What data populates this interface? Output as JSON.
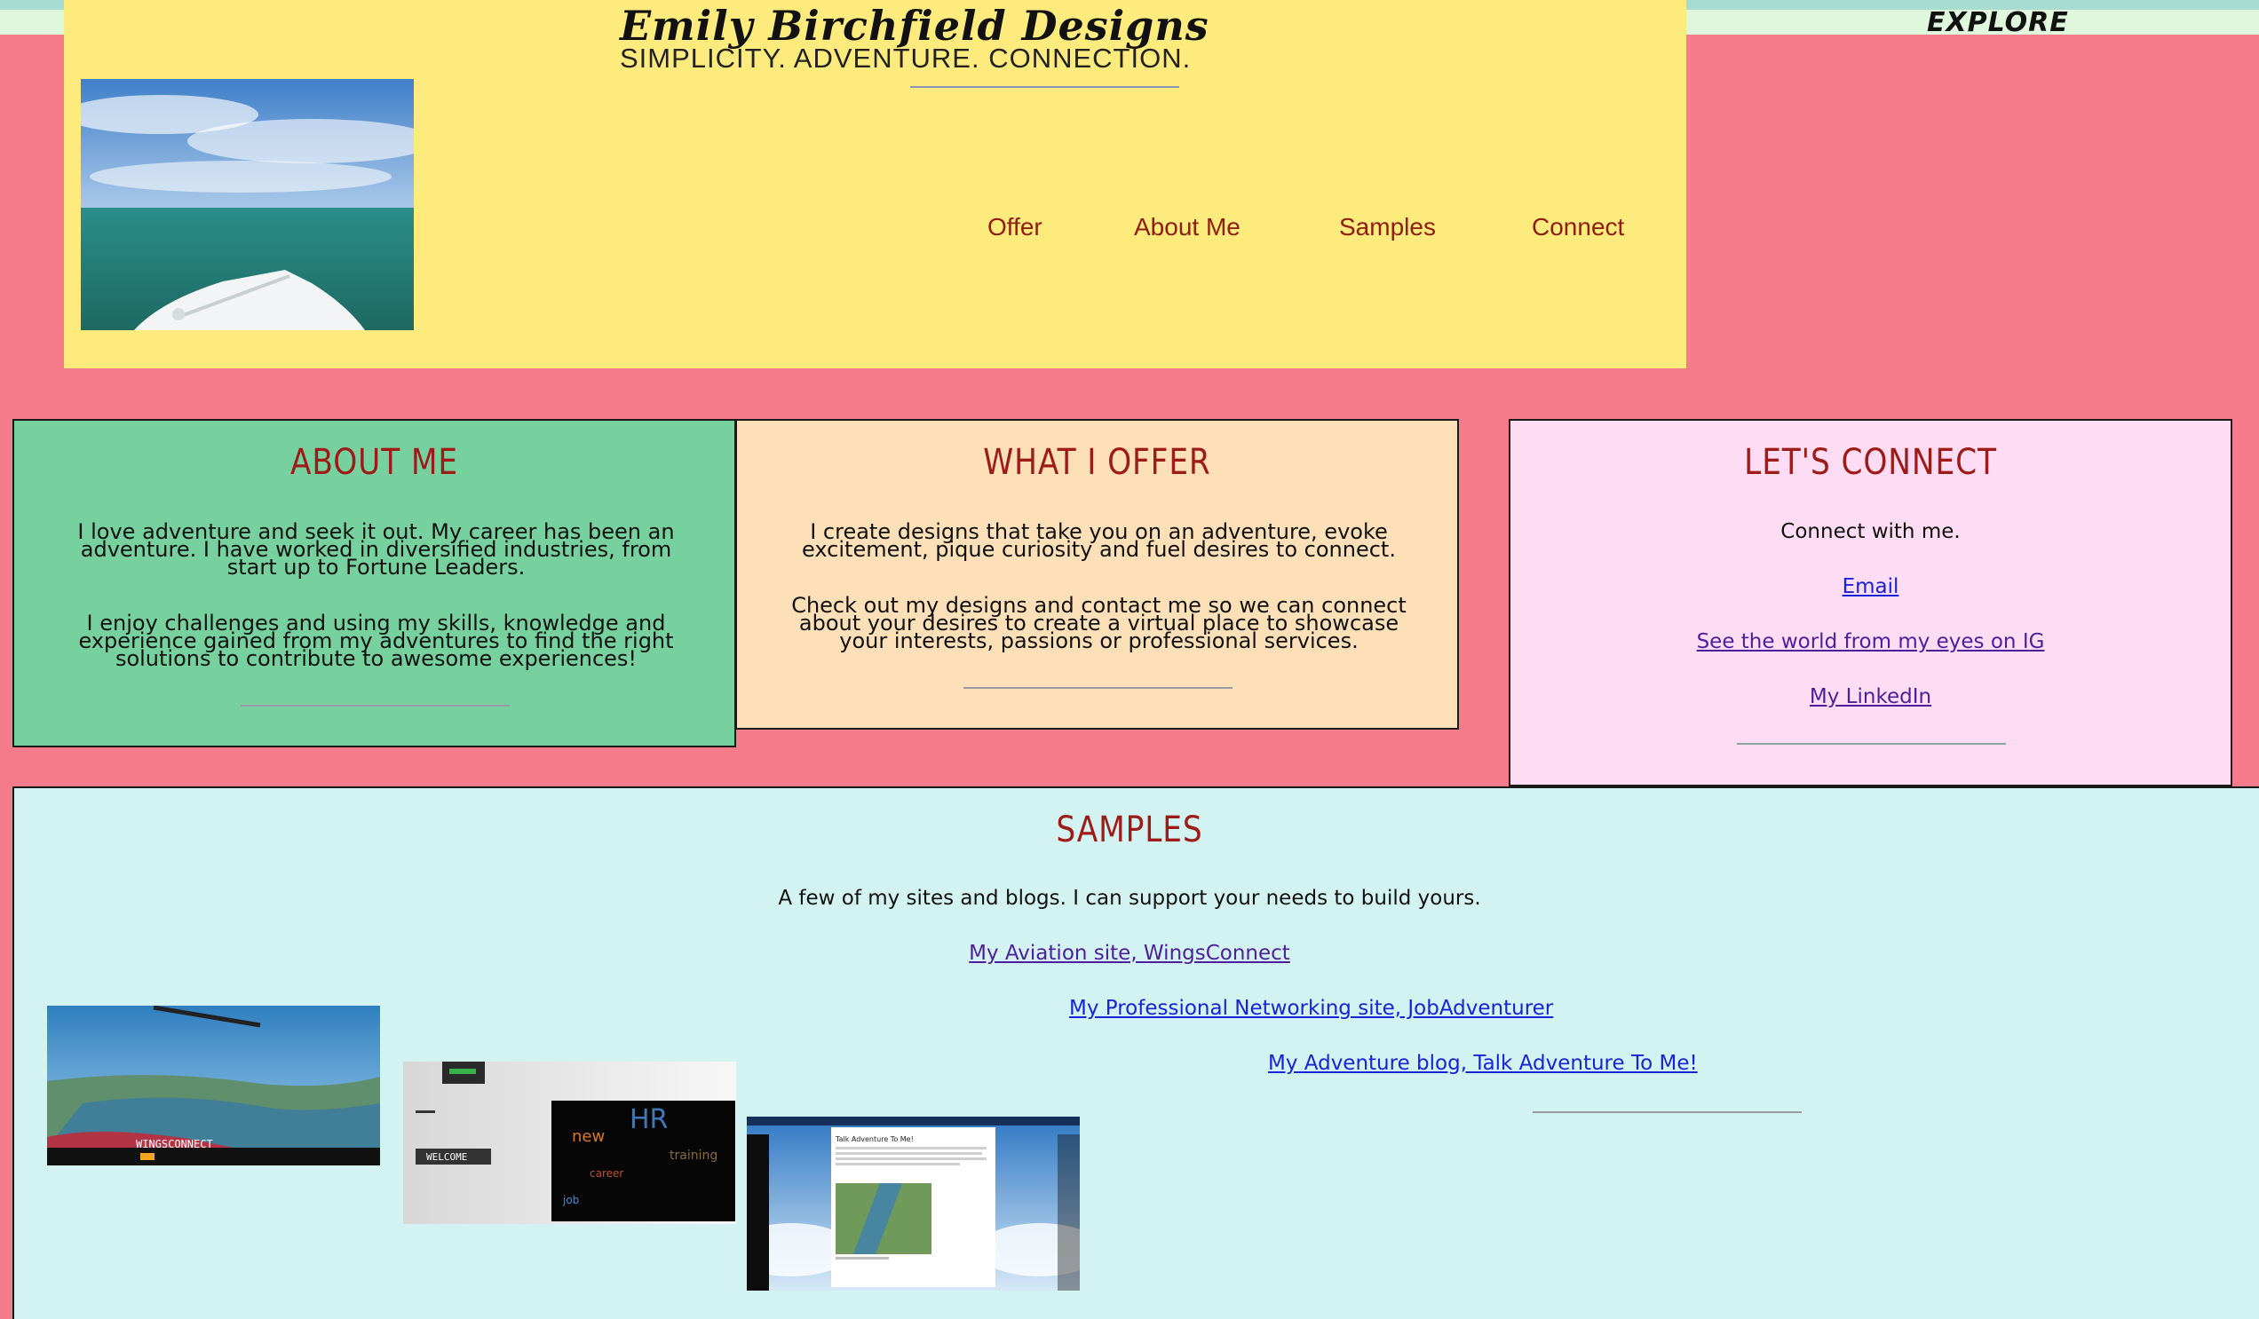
{
  "topbar": {
    "explore_label": "EXPLORE"
  },
  "header": {
    "title": "Emily Birchfield Designs",
    "tagline": "SIMPLICITY. ADVENTURE. CONNECTION.",
    "nav": [
      "Offer",
      "About Me",
      "Samples",
      "Connect"
    ]
  },
  "about": {
    "title": "ABOUT ME",
    "p1_lines": [
      "I love adventure and seek it out. My career has been an",
      "adventure. I have worked in diversified industries, from",
      "start up to Fortune Leaders."
    ],
    "p2_lines": [
      "I enjoy challenges and using my skills, knowledge and",
      "experience gained from my adventures to find the right",
      "solutions to contribute to awesome experiences!"
    ]
  },
  "offer": {
    "title": "WHAT I OFFER",
    "p1_lines": [
      "I create designs that take you on an adventure, evoke",
      "excitement, pique curiosity and fuel desires to connect."
    ],
    "p2_lines": [
      "Check out my designs and contact me so we can connect",
      "about your desires to create a virtual place to showcase",
      "your interests, passions or professional services."
    ]
  },
  "connect": {
    "title": "LET'S CONNECT",
    "intro": "Connect with me.",
    "links": [
      "Email",
      "See the world from my eyes on IG",
      "My LinkedIn"
    ]
  },
  "samples": {
    "title": "SAMPLES",
    "intro": "A few of my sites and blogs. I can support your needs to build yours.",
    "links": [
      "My Aviation site, WingsConnect",
      "My Professional Networking site, JobAdventurer",
      "My Adventure blog, Talk Adventure To Me!"
    ],
    "thumb1_text": "WINGSCONNECT",
    "thumb2_text": "WELCOME",
    "thumb3_text": "Talk Adventure To Me!"
  },
  "colors": {
    "page_bg": "#f67c8b",
    "header_bg": "#feeb7d",
    "about_bg": "#77d19f",
    "offer_bg": "#fde0b8",
    "connect_bg": "#fedcf4",
    "samples_bg": "#d3f3f2",
    "heading_red": "#9e1c18",
    "nav_red": "#8f1d10",
    "link_blue": "#1822d6",
    "link_visited": "#4d1f9a"
  }
}
